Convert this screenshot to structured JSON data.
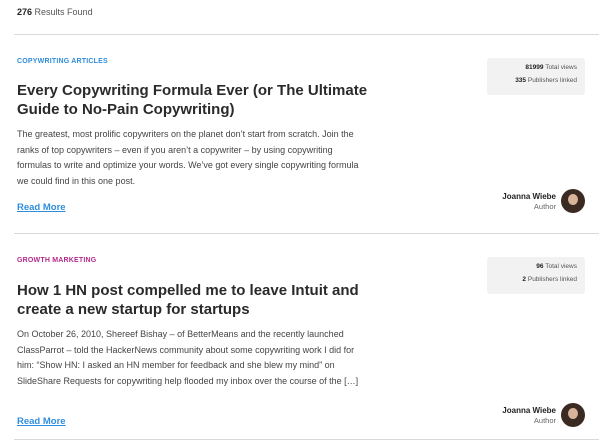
{
  "results": {
    "count": "276",
    "label": "Results Found"
  },
  "articles": [
    {
      "category": "Copywriting Articles",
      "category_color": "#2f8ddc",
      "title": "Every Copywriting Formula Ever (or The Ultimate Guide to No-Pain Copywriting)",
      "excerpt": "The greatest, most prolific copywriters on the planet don’t start from scratch. Join the ranks of top copywriters – even if you aren’t a copywriter – by using copywriting formulas to write and optimize your words. We’ve got every single copywriting formula we could find in this one post.",
      "read_more": "Read More",
      "total_views": "81999",
      "total_views_label": "Total views",
      "publishers": "335",
      "publishers_label": "Publishers linked",
      "author_name": "Joanna Wiebe",
      "author_role": "Author"
    },
    {
      "category": "Growth Marketing",
      "category_color": "#b52a8c",
      "title": "How 1 HN post compelled me to leave Intuit and create a new startup for startups",
      "excerpt": "On October 26, 2010, Shereef Bishay – of BetterMeans and the recently launched ClassParrot – told the HackerNews community about some copywriting work I did for him: “Show HN: I asked an HN member for feedback and she blew my mind” on SlideShare Requests for copywriting help flooded my inbox over the course of the […]",
      "read_more": "Read More",
      "total_views": "96",
      "total_views_label": "Total views",
      "publishers": "2",
      "publishers_label": "Publishers linked",
      "author_name": "Joanna Wiebe",
      "author_role": "Author"
    }
  ]
}
